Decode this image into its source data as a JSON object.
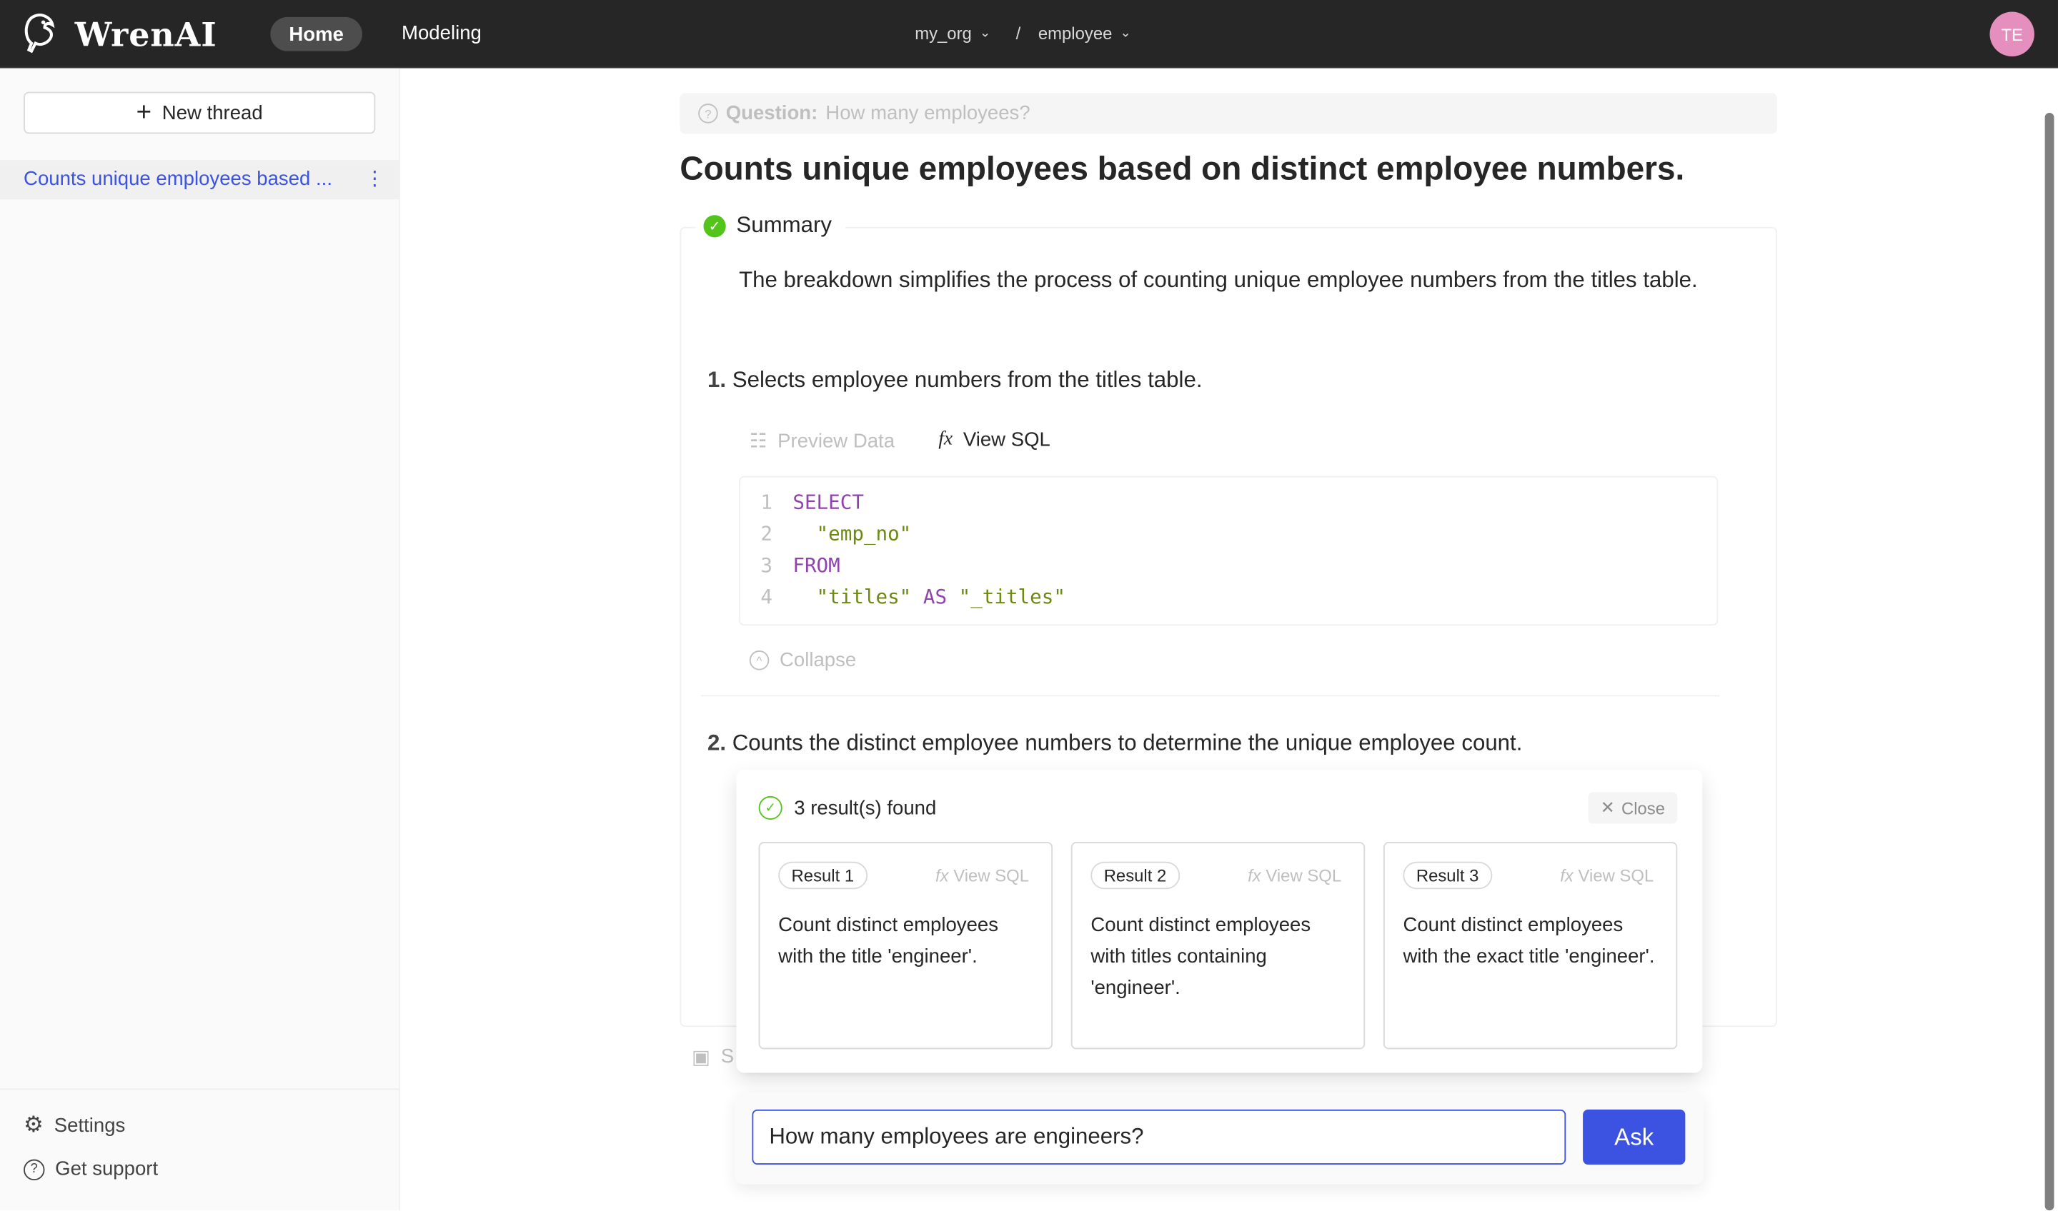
{
  "header": {
    "logo": "WrenAI",
    "nav": [
      {
        "label": "Home",
        "active": true
      },
      {
        "label": "Modeling"
      }
    ],
    "org": "my_org",
    "separator": "/",
    "project": "employee",
    "avatar": "TE",
    "avatar_color": "#e58fbf"
  },
  "sidebar": {
    "new_thread": "New thread",
    "threads": [
      {
        "label": "Counts unique employees based ...",
        "more": "⋮"
      }
    ],
    "footer": [
      {
        "label": "Settings",
        "icon": "gear-icon"
      },
      {
        "label": "Get support",
        "icon": "question-circle-icon"
      }
    ]
  },
  "main": {
    "question_label": "Question:",
    "question": "How many employees?",
    "title": "Counts unique employees based on distinct employee numbers.",
    "summary_label": "Summary",
    "summary_text": "The breakdown simplifies the process of counting unique employee numbers from the titles table.",
    "steps": [
      {
        "num": "1.",
        "text": "Selects employee numbers from the titles table."
      },
      {
        "num": "2.",
        "text": "Counts the distinct employee numbers to determine the unique employee count."
      }
    ],
    "tabs": {
      "preview": "Preview Data",
      "view_sql": "View SQL"
    },
    "code": [
      {
        "n": "1",
        "parts": [
          {
            "t": "SELECT",
            "c": "kw"
          }
        ]
      },
      {
        "n": "2",
        "parts": [
          {
            "t": "  \"emp_no\"",
            "c": "st"
          }
        ]
      },
      {
        "n": "3",
        "parts": [
          {
            "t": "FROM",
            "c": "kw"
          }
        ]
      },
      {
        "n": "4",
        "parts": [
          {
            "t": "  \"titles\"",
            "c": "st"
          },
          {
            "t": " AS ",
            "c": "kw"
          },
          {
            "t": "\"_titles\"",
            "c": "st"
          }
        ]
      }
    ],
    "collapse": "Collapse",
    "save_partial": "S"
  },
  "popup": {
    "found": "3 result(s) found",
    "close": "Close",
    "results": [
      {
        "tag": "Result 1",
        "view_sql": "View SQL",
        "text": "Count distinct employees with the title 'engineer'."
      },
      {
        "tag": "Result 2",
        "view_sql": "View SQL",
        "text": "Count distinct employees with titles containing 'engineer'."
      },
      {
        "tag": "Result 3",
        "view_sql": "View SQL",
        "text": "Count distinct employees with the exact title 'engineer'."
      }
    ]
  },
  "ask": {
    "value": "How many employees are engineers?",
    "button": "Ask",
    "accent": "#3b53e0"
  }
}
